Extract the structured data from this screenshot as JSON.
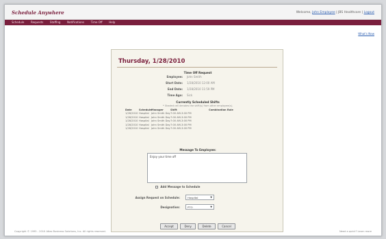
{
  "header": {
    "logo_text": "Schedule Anywhere",
    "welcome_prefix": "Welcome,",
    "user_link": "John Employee",
    "separator_text": "| JBS Healthcare |",
    "logout_link": "Logout"
  },
  "navbar": {
    "items": [
      "Schedule",
      "Requests",
      "Staffing",
      "Notifications",
      "Time Off",
      "Help"
    ]
  },
  "whats_new": "What's New",
  "panel": {
    "day_title": "Thursday, 1/28/2010",
    "time_off_request": {
      "title": "Time Off Request",
      "rows": [
        {
          "label": "Employee:",
          "value": "John Smith"
        },
        {
          "label": "Start Date:",
          "value": "1/28/2010 12:00 AM"
        },
        {
          "label": "End Date:",
          "value": "1/28/2010 11:59 PM"
        },
        {
          "label": "Time Ago:",
          "value": "Sick"
        }
      ]
    },
    "scheduled_shifts": {
      "title": "Currently Scheduled Shifts",
      "note": "* Shaded cell denotes the shift(s) from other employee(s).",
      "headers": [
        "Date",
        "Schedule",
        "Manager",
        "Shift",
        "Combination Role"
      ],
      "rows": [
        [
          "1/28/2010",
          "Hospital",
          "John Smith Day",
          "7:00 AM-3:00 PM",
          ""
        ],
        [
          "1/28/2010",
          "Hospital",
          "John Smith Day",
          "7:00 AM-3:00 PM",
          ""
        ],
        [
          "1/28/2010",
          "Hospital",
          "John Smith Day",
          "7:00 AM-3:00 PM",
          ""
        ],
        [
          "1/28/2010",
          "Hospital",
          "John Smith Day",
          "7:00 AM-3:00 PM",
          ""
        ],
        [
          "1/28/2010",
          "Hospital",
          "John Smith Day",
          "7:00 AM-3:00 PM",
          ""
        ]
      ]
    },
    "message": {
      "title": "Message To Employee:",
      "value": "Enjoy your time off"
    },
    "add_message_checkbox": {
      "label": "Add Message to Schedule",
      "checked": false
    },
    "assign_request": {
      "label": "Assign Request on Schedule:",
      "value": "Hospital"
    },
    "designation": {
      "label": "Designation:",
      "value": "PTO"
    },
    "buttons": [
      "Accept",
      "Deny",
      "Delete",
      "Cancel"
    ]
  },
  "footer": {
    "left": "Copyright © 1995 - 2010 Atlas Business Solutions, Inc. All rights reserved.",
    "right": "Need a quick? Learn more"
  },
  "colors": {
    "brand": "#7a1f3d",
    "panel_bg": "#f6f4ec",
    "link": "#2a5db0"
  }
}
